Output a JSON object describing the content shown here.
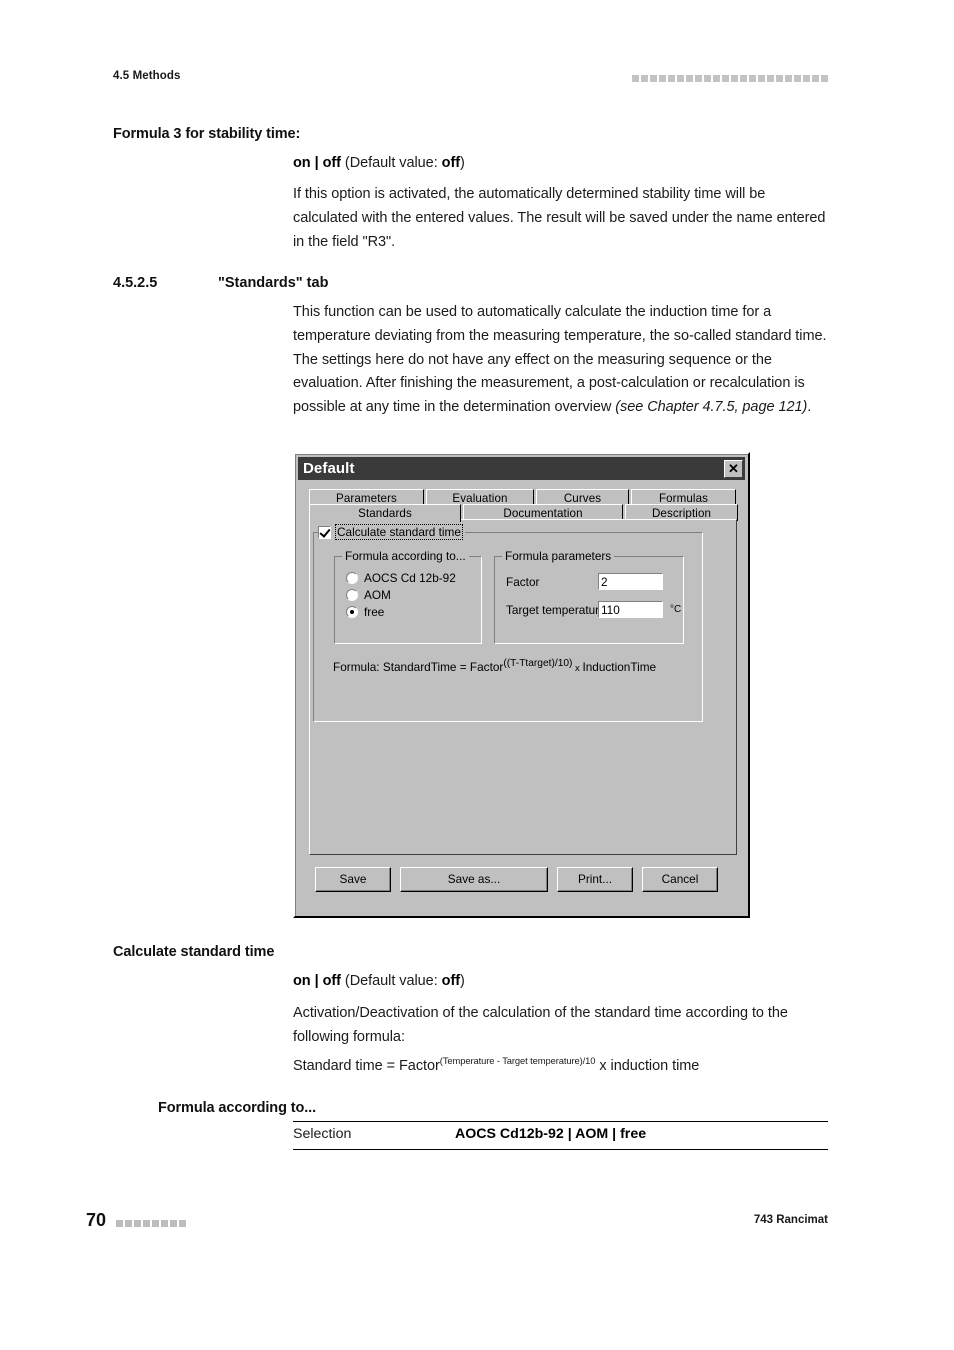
{
  "page_header": {
    "left_text": "4.5 Methods",
    "decor_squares": 22
  },
  "sections": [
    {
      "heading": "Formula 3 for stability time:",
      "value_line_bold_1": "on | off",
      "value_line_rest": " (Default value: ",
      "value_line_bold_2": "off",
      "value_line_close": ")",
      "body": "If this option is activated, the automatically determined stability time will be calculated with the entered values. The result will be saved under the name entered in the field \"R3\"."
    },
    {
      "number": "4.5.2.5",
      "heading": "\"Standards\" tab",
      "body": "This function can be used to automatically calculate the induction time for a temperature deviating from the measuring temperature, the so-called standard time. The settings here do not have any effect on the measuring sequence or the evaluation. After finishing the measurement, a post-calculation or recalculation is possible at any time in the determination overview ",
      "body_italic": "(see Chapter 4.7.5, page 121)",
      "body_tail": "."
    },
    {
      "heading": "Calculate standard time",
      "value_line_bold_1": "on | off",
      "value_line_rest": " (Default value: ",
      "value_line_bold_2": "off",
      "value_line_close": ")",
      "body": "Activation/Deactivation of the calculation of the standard time according to the following formula:",
      "formula_base": "Standard time = Factor",
      "formula_exponent": "(Temperature - Target temperature)/10",
      "formula_tail": " x induction time"
    },
    {
      "heading": "Formula according to..."
    }
  ],
  "selection_table": {
    "rows": [
      {
        "key": "Selection",
        "value": "AOCS Cd12b-92 | AOM | free"
      }
    ]
  },
  "footer": {
    "page_number": "70",
    "decor_squares": 8,
    "right_text": "743 Rancimat"
  },
  "dialog": {
    "title": "Default",
    "close_label": "✕",
    "tabs_row1": [
      {
        "label": "Parameters",
        "active": false
      },
      {
        "label": "Evaluation",
        "active": false
      },
      {
        "label": "Curves",
        "active": false
      },
      {
        "label": "Formulas",
        "active": false
      }
    ],
    "tabs_row2": [
      {
        "label": "Standards",
        "active": true
      },
      {
        "label": "Documentation",
        "active": false
      },
      {
        "label": "Description",
        "active": false
      }
    ],
    "calculate_standard_time": {
      "label": "Calculate standard time",
      "checked": true
    },
    "formula_according_to": {
      "caption": "Formula according to...",
      "options": [
        {
          "label": "AOCS Cd 12b-92",
          "selected": false
        },
        {
          "label": "AOM",
          "selected": false
        },
        {
          "label": "free",
          "selected": true
        }
      ]
    },
    "formula_parameters": {
      "caption": "Formula parameters",
      "factor": {
        "label": "Factor",
        "value": "2"
      },
      "target_temperature": {
        "label": "Target temperature",
        "value": "110",
        "unit": "°C"
      }
    },
    "formula_caption": {
      "prefix": "Formula:  StandardTime = Factor",
      "exponent": "((T-Ttarget)/10)",
      "multiplier": " x ",
      "tail": "InductionTime"
    },
    "buttons": [
      {
        "label": "Save"
      },
      {
        "label": "Save as..."
      },
      {
        "label": "Print..."
      },
      {
        "label": "Cancel"
      }
    ]
  }
}
